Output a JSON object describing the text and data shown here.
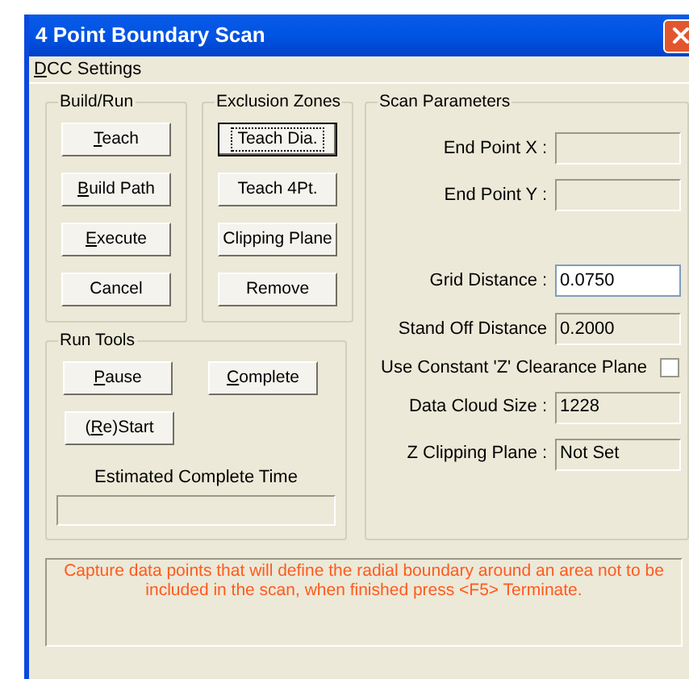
{
  "window": {
    "title": "4 Point Boundary Scan"
  },
  "menu": [
    {
      "label": "DCC Settings",
      "access_key": true
    }
  ],
  "build_run": {
    "title": "Build/Run",
    "buttons": [
      {
        "label": "Teach",
        "access_key": true,
        "focused": false
      },
      {
        "label": "Build Path",
        "access_key": true,
        "focused": false
      },
      {
        "label": "Execute",
        "access_key": true,
        "focused": false
      },
      {
        "label": "Cancel",
        "access_key": false,
        "focused": false
      }
    ]
  },
  "exclusion_zones": {
    "title": "Exclusion Zones",
    "buttons": [
      {
        "label": "Teach Dia.",
        "access_key": false,
        "focused": true
      },
      {
        "label": "Teach 4Pt.",
        "access_key": false,
        "focused": false
      },
      {
        "label": "Clipping Plane",
        "access_key": false,
        "focused": false
      },
      {
        "label": "Remove",
        "access_key": false,
        "focused": false
      }
    ]
  },
  "run_tools": {
    "title": "Run Tools",
    "buttons": [
      {
        "label": "Pause",
        "access_key": true,
        "focused": false
      },
      {
        "label": "Complete",
        "access_key": true,
        "focused": false
      },
      {
        "label": "(Re)Start",
        "access_key": true,
        "focused": false
      }
    ],
    "estimate_label": "Estimated Complete Time"
  },
  "scan_parameters": {
    "title": "Scan Parameters",
    "rows": [
      {
        "kind": "field",
        "label": "End Point X :",
        "editable": false
      },
      {
        "kind": "field",
        "label": "End Point Y :",
        "editable": false
      },
      {
        "kind": "field",
        "label": "Grid Distance :",
        "value": "0.0750",
        "editable": true
      },
      {
        "kind": "field",
        "label": "Stand Off Distance",
        "value": "0.2000",
        "editable": false
      },
      {
        "kind": "checkbox",
        "label": "Use Constant 'Z' Clearance Plane",
        "checked": false
      },
      {
        "kind": "field",
        "label": "Data Cloud Size :",
        "value": "1228",
        "editable": false
      },
      {
        "kind": "field",
        "label": "Z Clipping Plane :",
        "value": "Not Set",
        "editable": false
      }
    ]
  },
  "message": "Capture data points that will define the radial boundary around an area not to be included in the scan, when finished press <F5> Terminate."
}
